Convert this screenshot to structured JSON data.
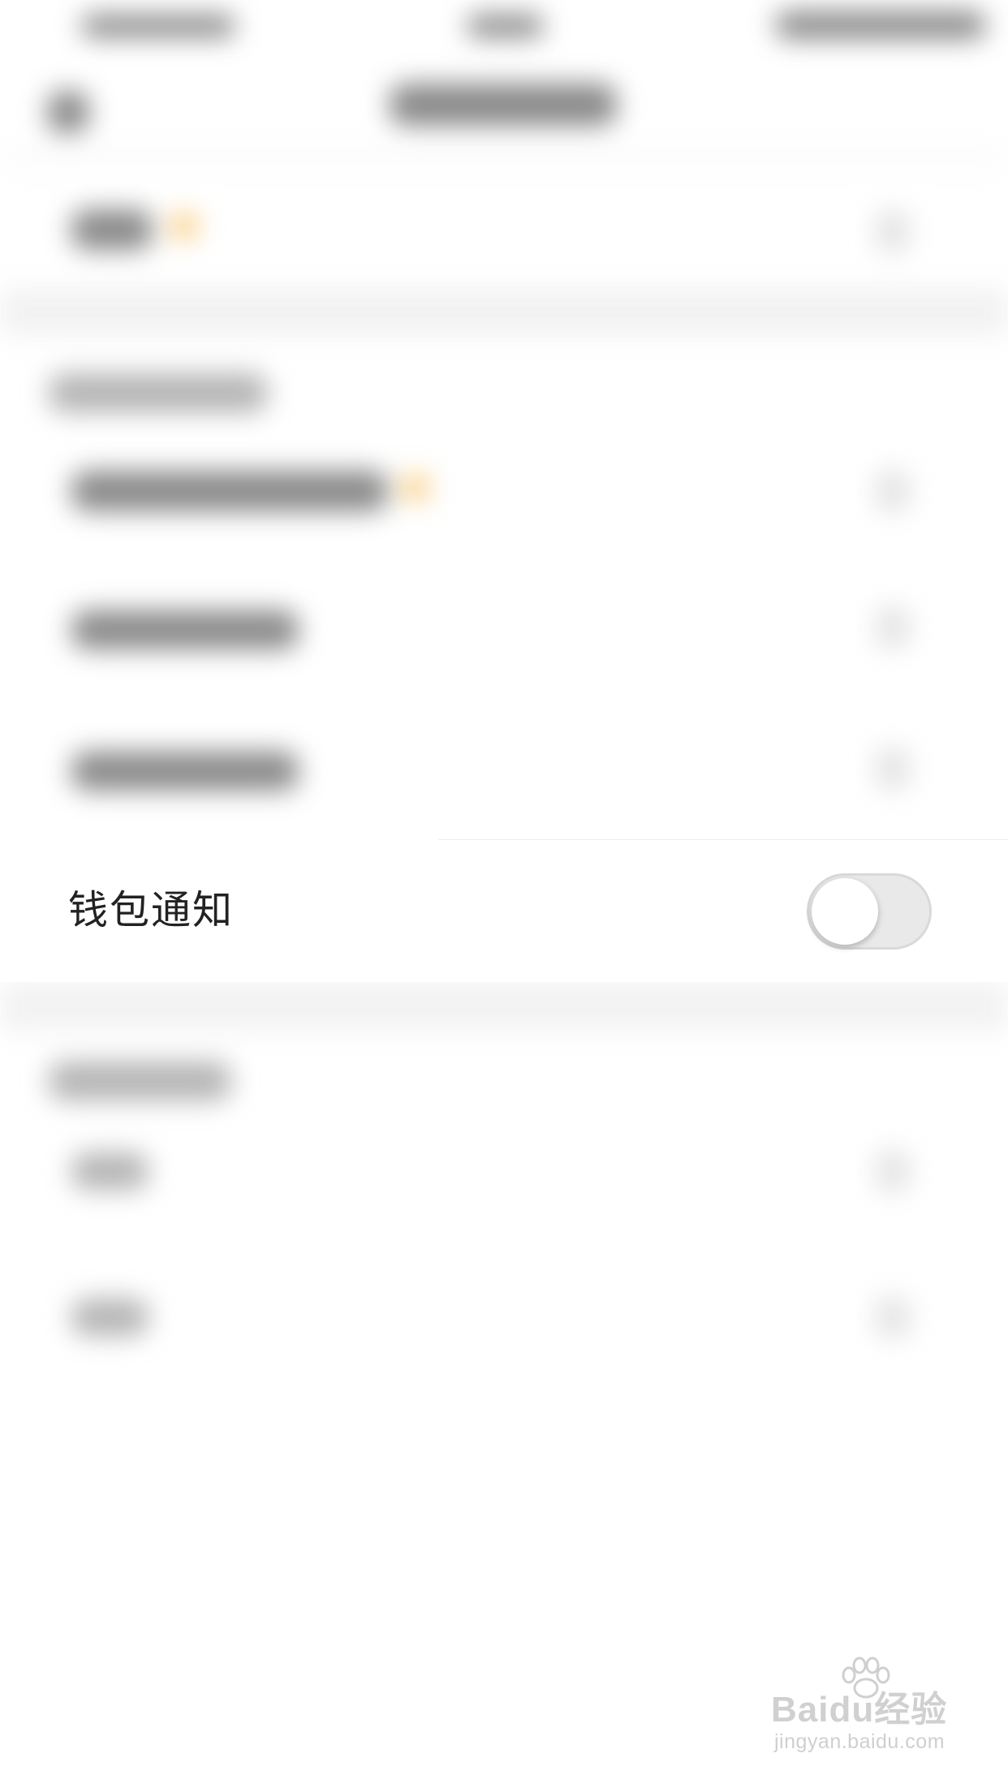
{
  "settings": {
    "wallet_notification": {
      "label": "钱包通知",
      "enabled": false
    }
  },
  "watermark": {
    "brand": "Baidu经验",
    "url": "jingyan.baidu.com"
  },
  "colors": {
    "background": "#ffffff",
    "separator": "#f2f2f2",
    "accent_dot": "#f5a623",
    "toggle_off": "#e9e9ea",
    "label_text": "#222222"
  }
}
